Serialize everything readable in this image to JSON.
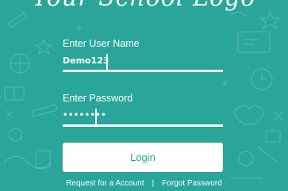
{
  "colors": {
    "background": "#2aa59a",
    "foreground": "#ffffff",
    "button_text": "#2aa59a"
  },
  "logo": {
    "text": "Your School Logo"
  },
  "form": {
    "username_label": "Enter User Name",
    "username_value": "Demo123",
    "password_label": "Enter Password",
    "password_value": "••••••••",
    "login_label": "Login"
  },
  "footer": {
    "request_account": "Request for a  Account",
    "separator": "|",
    "forgot_password": "Forgot Password"
  }
}
